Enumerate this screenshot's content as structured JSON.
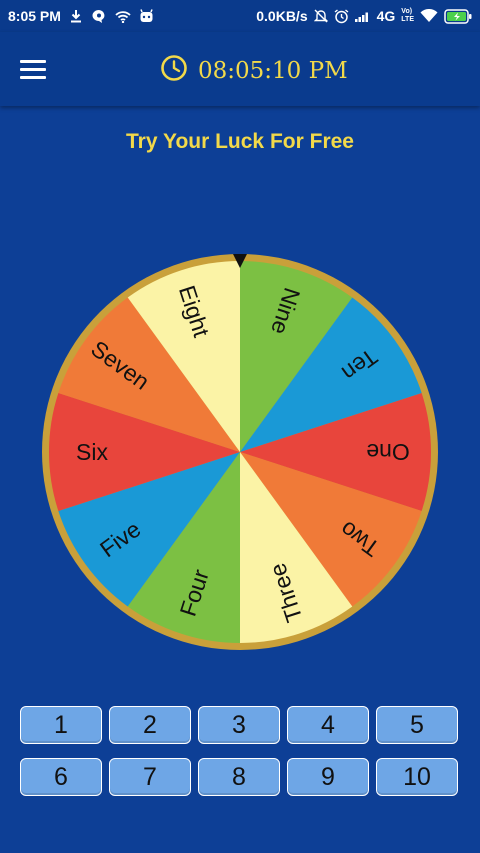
{
  "status_bar": {
    "time": "8:05 PM",
    "speed": "0.0KB/s",
    "network": "4G",
    "volte_top": "Vo)",
    "volte_bottom": "LTE"
  },
  "header": {
    "clock_time": "08:05:10 PM",
    "menu_icon": "hamburger-menu-icon",
    "clock_icon": "clock-icon"
  },
  "title": "Try Your Luck For Free",
  "wheel": {
    "segments": [
      {
        "label": "One",
        "color": "#e8453c"
      },
      {
        "label": "Two",
        "color": "#f07a38"
      },
      {
        "label": "Three",
        "color": "#fbf3a6"
      },
      {
        "label": "Four",
        "color": "#7cc043"
      },
      {
        "label": "Five",
        "color": "#1a99d6"
      },
      {
        "label": "Six",
        "color": "#e8453c"
      },
      {
        "label": "Seven",
        "color": "#f07a38"
      },
      {
        "label": "Eight",
        "color": "#fbf3a6"
      },
      {
        "label": "Nine",
        "color": "#7cc043"
      },
      {
        "label": "Ten",
        "color": "#1a99d6"
      }
    ],
    "rim_color": "#c9a03a",
    "pointer_icon": "pointer-triangle-icon"
  },
  "buttons": [
    "1",
    "2",
    "3",
    "4",
    "5",
    "6",
    "7",
    "8",
    "9",
    "10"
  ],
  "colors": {
    "background": "#0d3f96",
    "accent": "#f2d94a",
    "button": "#6ea6e6"
  }
}
